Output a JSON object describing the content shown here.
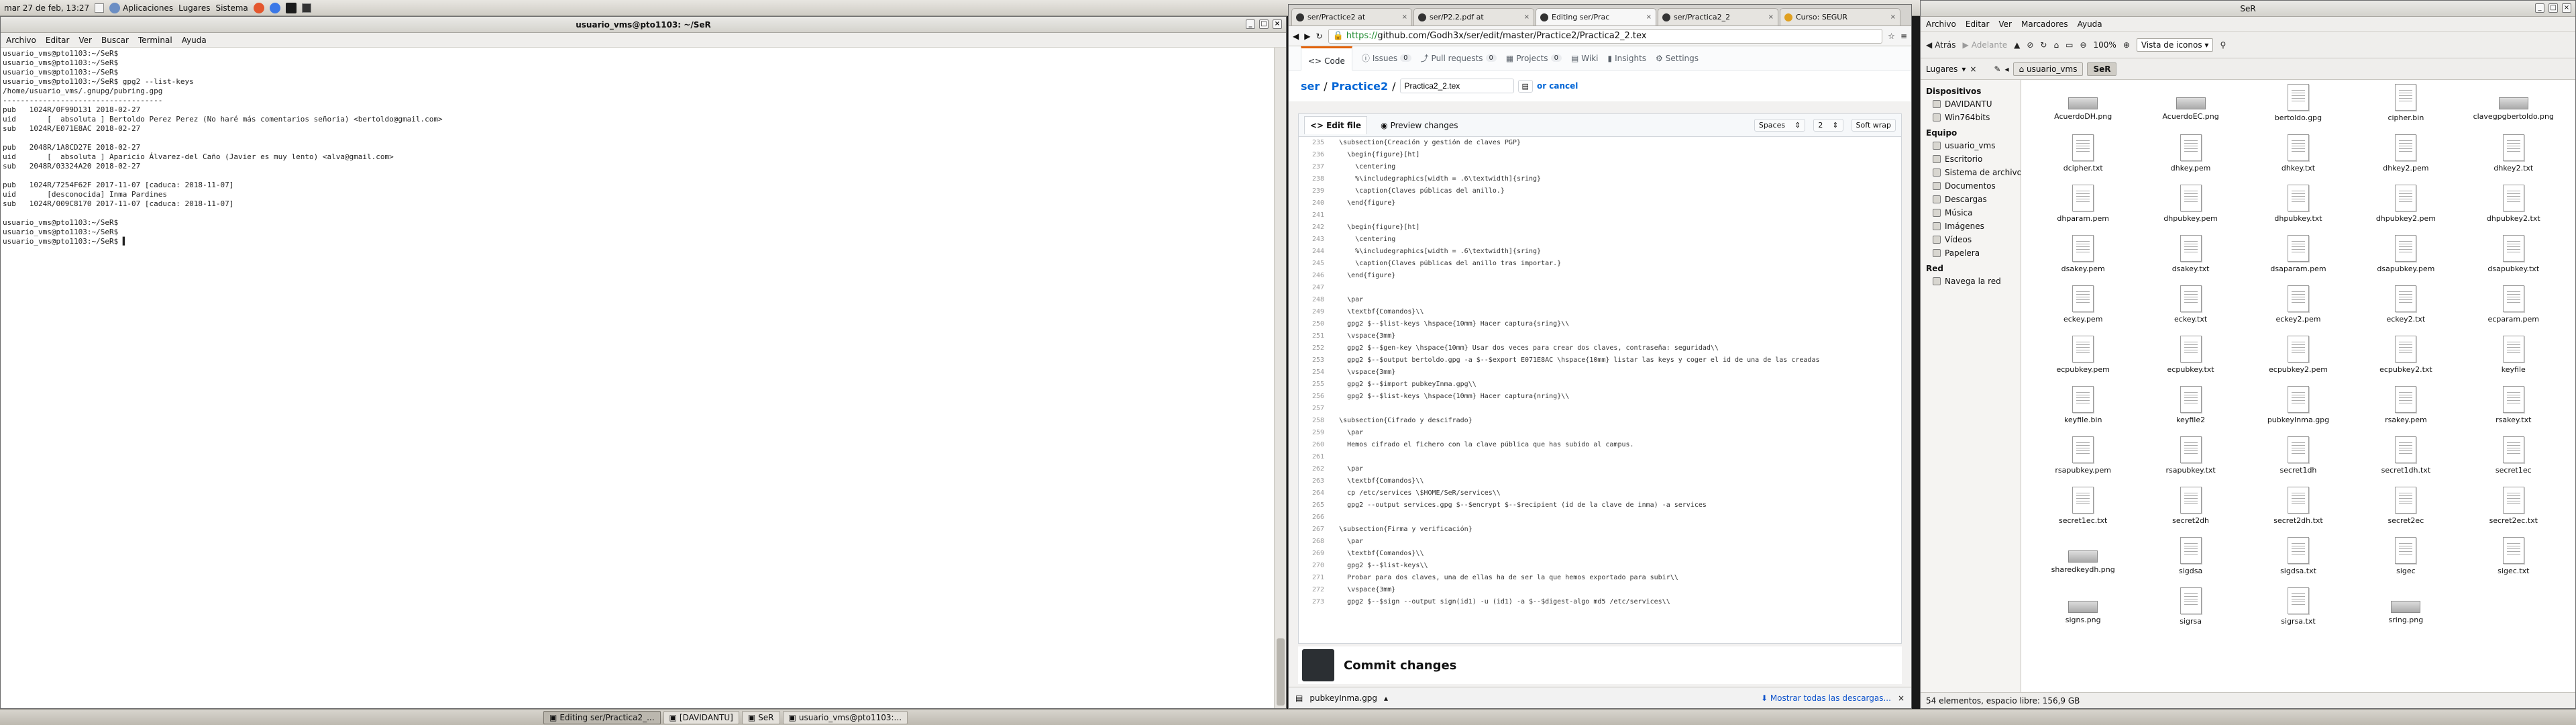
{
  "topbar": {
    "datetime": "mar 27 de feb, 13:27",
    "menus": [
      "Aplicaciones",
      "Lugares",
      "Sistema"
    ]
  },
  "terminal": {
    "title": "usuario_vms@pto1103: ~/SeR",
    "menu": [
      "Archivo",
      "Editar",
      "Ver",
      "Buscar",
      "Terminal",
      "Ayuda"
    ],
    "lines": [
      "usuario_vms@pto1103:~/SeR$",
      "usuario_vms@pto1103:~/SeR$",
      "usuario_vms@pto1103:~/SeR$",
      "usuario_vms@pto1103:~/SeR$ gpg2 --list-keys",
      "/home/usuario_vms/.gnupg/pubring.gpg",
      "------------------------------------",
      "pub   1024R/0F99D131 2018-02-27",
      "uid       [  absoluta ] Bertoldo Perez Perez (No haré más comentarios señoria) <bertoldo@gmail.com>",
      "sub   1024R/E071E8AC 2018-02-27",
      "",
      "pub   2048R/1A8CD27E 2018-02-27",
      "uid       [  absoluta ] Aparicio Álvarez-del Caño (Javier es muy lento) <alva@gmail.com>",
      "sub   2048R/03324A20 2018-02-27",
      "",
      "pub   1024R/7254F62F 2017-11-07 [caduca: 2018-11-07]",
      "uid       [desconocida] Inma Pardines",
      "sub   1024R/009C8170 2017-11-07 [caduca: 2018-11-07]",
      "",
      "usuario_vms@pto1103:~/SeR$",
      "usuario_vms@pto1103:~/SeR$",
      "usuario_vms@pto1103:~/SeR$ ▌"
    ]
  },
  "browser": {
    "tabs": [
      {
        "label": "ser/Practice2 at"
      },
      {
        "label": "ser/P2.2.pdf at"
      },
      {
        "label": "Editing ser/Prac"
      },
      {
        "label": "ser/Practica2_2"
      },
      {
        "label": "Curso: SEGUR"
      }
    ],
    "url_secure": "https://",
    "url_rest": "github.com/Godh3x/ser/edit/master/Practice2/Practica2_2.tex",
    "nav": [
      {
        "label": "Code"
      },
      {
        "label": "Issues",
        "count": "0"
      },
      {
        "label": "Pull requests",
        "count": "0"
      },
      {
        "label": "Projects",
        "count": "0"
      },
      {
        "label": "Wiki"
      },
      {
        "label": "Insights"
      },
      {
        "label": "Settings"
      }
    ],
    "crumb_repo": "ser",
    "crumb_dir": "Practice2",
    "filename": "Practica2_2.tex",
    "cancel": "or cancel",
    "edit_file": "Edit file",
    "preview": "Preview changes",
    "indent": "Spaces",
    "indent_size": "2",
    "wrap": "Soft wrap",
    "code": [
      {
        "n": "235",
        "t": "  \\subsection{Creación y gestión de claves PGP}"
      },
      {
        "n": "236",
        "t": "    \\begin{figure}[ht]"
      },
      {
        "n": "237",
        "t": "      \\centering"
      },
      {
        "n": "238",
        "t": "      %\\includegraphics[width = .6\\textwidth]{sring}"
      },
      {
        "n": "239",
        "t": "      \\caption{Claves públicas del anillo.}"
      },
      {
        "n": "240",
        "t": "    \\end{figure}"
      },
      {
        "n": "241",
        "t": ""
      },
      {
        "n": "242",
        "t": "    \\begin{figure}[ht]"
      },
      {
        "n": "243",
        "t": "      \\centering"
      },
      {
        "n": "244",
        "t": "      %\\includegraphics[width = .6\\textwidth]{sring}"
      },
      {
        "n": "245",
        "t": "      \\caption{Claves públicas del anillo tras importar.}"
      },
      {
        "n": "246",
        "t": "    \\end{figure}"
      },
      {
        "n": "247",
        "t": ""
      },
      {
        "n": "248",
        "t": "    \\par"
      },
      {
        "n": "249",
        "t": "    \\textbf{Comandos}\\\\"
      },
      {
        "n": "250",
        "t": "    gpg2 $--$list-keys \\hspace{10mm} Hacer captura{sring}\\\\"
      },
      {
        "n": "251",
        "t": "    \\vspace{3mm}"
      },
      {
        "n": "252",
        "t": "    gpg2 $--$gen-key \\hspace{10mm} Usar dos veces para crear dos claves, contraseña: seguridad\\\\"
      },
      {
        "n": "253",
        "t": "    gpg2 $--$output bertoldo.gpg -a $--$export E071E8AC \\hspace{10mm} listar las keys y coger el id de una de las creadas"
      },
      {
        "n": "254",
        "t": "    \\vspace{3mm}"
      },
      {
        "n": "255",
        "t": "    gpg2 $--$import pubkeyInma.gpg\\\\"
      },
      {
        "n": "256",
        "t": "    gpg2 $--$list-keys \\hspace{10mm} Hacer captura{nring}\\\\"
      },
      {
        "n": "257",
        "t": ""
      },
      {
        "n": "258",
        "t": "  \\subsection{Cifrado y descifrado}"
      },
      {
        "n": "259",
        "t": "    \\par"
      },
      {
        "n": "260",
        "t": "    Hemos cifrado el fichero con la clave pública que has subido al campus."
      },
      {
        "n": "261",
        "t": ""
      },
      {
        "n": "262",
        "t": "    \\par"
      },
      {
        "n": "263",
        "t": "    \\textbf{Comandos}\\\\"
      },
      {
        "n": "264",
        "t": "    cp /etc/services \\$HOME/SeR/services\\\\"
      },
      {
        "n": "265",
        "t": "    gpg2 --output services.gpg $--$encrypt $--$recipient (id de la clave de inma) -a services"
      },
      {
        "n": "266",
        "t": ""
      },
      {
        "n": "267",
        "t": "  \\subsection{Firma y verificación}"
      },
      {
        "n": "268",
        "t": "    \\par"
      },
      {
        "n": "269",
        "t": "    \\textbf{Comandos}\\\\"
      },
      {
        "n": "270",
        "t": "    gpg2 $--$list-keys\\\\"
      },
      {
        "n": "271",
        "t": "    Probar para dos claves, una de ellas ha de ser la que hemos exportado para subir\\\\"
      },
      {
        "n": "272",
        "t": "    \\vspace{3mm}"
      },
      {
        "n": "273",
        "t": "    gpg2 $--$sign --output sign(id1) -u (id1) -a $--$digest-algo md5 /etc/services\\\\"
      }
    ],
    "commit_title": "Commit changes",
    "download_file": "pubkeyInma.gpg",
    "download_all": "Mostrar todas las descargas..."
  },
  "filemanager": {
    "title": "SeR",
    "menu": [
      "Archivo",
      "Editar",
      "Ver",
      "Marcadores",
      "Ayuda"
    ],
    "back": "Atrás",
    "forward": "Adelante",
    "zoom": "100%",
    "view_mode": "Vista de iconos",
    "places_label": "Lugares",
    "path": [
      "usuario_vms",
      "SeR"
    ],
    "sidebar": {
      "devices_title": "Dispositivos",
      "devices": [
        "DAVIDANTU",
        "Win764bits"
      ],
      "computer_title": "Equipo",
      "computer": [
        "usuario_vms",
        "Escritorio",
        "Sistema de archivos",
        "Documentos",
        "Descargas",
        "Música",
        "Imágenes",
        "Vídeos",
        "Papelera"
      ],
      "network_title": "Red",
      "network": [
        "Navega la red"
      ]
    },
    "files": [
      {
        "name": "AcuerdoDH.png",
        "type": "img"
      },
      {
        "name": "AcuerdoEC.png",
        "type": "img"
      },
      {
        "name": "bertoldo.gpg",
        "type": "doc"
      },
      {
        "name": "cipher.bin",
        "type": "doc"
      },
      {
        "name": "clavegpgbertoldo.png",
        "type": "img"
      },
      {
        "name": "dcipher.txt",
        "type": "doc"
      },
      {
        "name": "dhkey.pem",
        "type": "doc"
      },
      {
        "name": "dhkey.txt",
        "type": "doc"
      },
      {
        "name": "dhkey2.pem",
        "type": "doc"
      },
      {
        "name": "dhkey2.txt",
        "type": "doc"
      },
      {
        "name": "dhparam.pem",
        "type": "doc"
      },
      {
        "name": "dhpubkey.pem",
        "type": "doc"
      },
      {
        "name": "dhpubkey.txt",
        "type": "doc"
      },
      {
        "name": "dhpubkey2.pem",
        "type": "doc"
      },
      {
        "name": "dhpubkey2.txt",
        "type": "doc"
      },
      {
        "name": "dsakey.pem",
        "type": "doc"
      },
      {
        "name": "dsakey.txt",
        "type": "doc"
      },
      {
        "name": "dsaparam.pem",
        "type": "doc"
      },
      {
        "name": "dsapubkey.pem",
        "type": "doc"
      },
      {
        "name": "dsapubkey.txt",
        "type": "doc"
      },
      {
        "name": "eckey.pem",
        "type": "doc"
      },
      {
        "name": "eckey.txt",
        "type": "doc"
      },
      {
        "name": "eckey2.pem",
        "type": "doc"
      },
      {
        "name": "eckey2.txt",
        "type": "doc"
      },
      {
        "name": "ecparam.pem",
        "type": "doc"
      },
      {
        "name": "ecpubkey.pem",
        "type": "doc"
      },
      {
        "name": "ecpubkey.txt",
        "type": "doc"
      },
      {
        "name": "ecpubkey2.pem",
        "type": "doc"
      },
      {
        "name": "ecpubkey2.txt",
        "type": "doc"
      },
      {
        "name": "keyfile",
        "type": "doc"
      },
      {
        "name": "keyfile.bin",
        "type": "doc"
      },
      {
        "name": "keyfile2",
        "type": "doc"
      },
      {
        "name": "pubkeyInma.gpg",
        "type": "doc"
      },
      {
        "name": "rsakey.pem",
        "type": "doc"
      },
      {
        "name": "rsakey.txt",
        "type": "doc"
      },
      {
        "name": "rsapubkey.pem",
        "type": "doc"
      },
      {
        "name": "rsapubkey.txt",
        "type": "doc"
      },
      {
        "name": "secret1dh",
        "type": "doc"
      },
      {
        "name": "secret1dh.txt",
        "type": "doc"
      },
      {
        "name": "secret1ec",
        "type": "doc"
      },
      {
        "name": "secret1ec.txt",
        "type": "doc"
      },
      {
        "name": "secret2dh",
        "type": "doc"
      },
      {
        "name": "secret2dh.txt",
        "type": "doc"
      },
      {
        "name": "secret2ec",
        "type": "doc"
      },
      {
        "name": "secret2ec.txt",
        "type": "doc"
      },
      {
        "name": "sharedkeydh.png",
        "type": "img"
      },
      {
        "name": "sigdsa",
        "type": "doc"
      },
      {
        "name": "sigdsa.txt",
        "type": "doc"
      },
      {
        "name": "sigec",
        "type": "doc"
      },
      {
        "name": "sigec.txt",
        "type": "doc"
      },
      {
        "name": "signs.png",
        "type": "img"
      },
      {
        "name": "sigrsa",
        "type": "doc"
      },
      {
        "name": "sigrsa.txt",
        "type": "doc"
      },
      {
        "name": "sring.png",
        "type": "img"
      }
    ],
    "status": "54 elementos, espacio libre: 156,9 GB"
  },
  "taskbar": [
    {
      "label": "Editing ser/Practica2_..."
    },
    {
      "label": "[DAVIDANTU]"
    },
    {
      "label": "SeR"
    },
    {
      "label": "usuario_vms@pto1103:..."
    }
  ]
}
